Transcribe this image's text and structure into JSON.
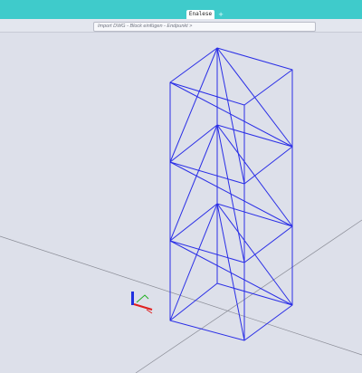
{
  "app": {
    "tab_label": "Enalese",
    "new_tab_symbol": "+"
  },
  "command_line": {
    "text": "Import DWG - Block einfügen - Endpunkt >"
  },
  "viewport": {
    "background_color": "#dde0ea",
    "model_color": "#2a2ee6",
    "grid_line_color": "#8a8c96",
    "model_description": "3D wireframe tower of three braced bays"
  },
  "ucs_icon": {
    "x_axis_color": "#e02020",
    "y_axis_color": "#20b020",
    "z_axis_color": "#2030e0"
  }
}
